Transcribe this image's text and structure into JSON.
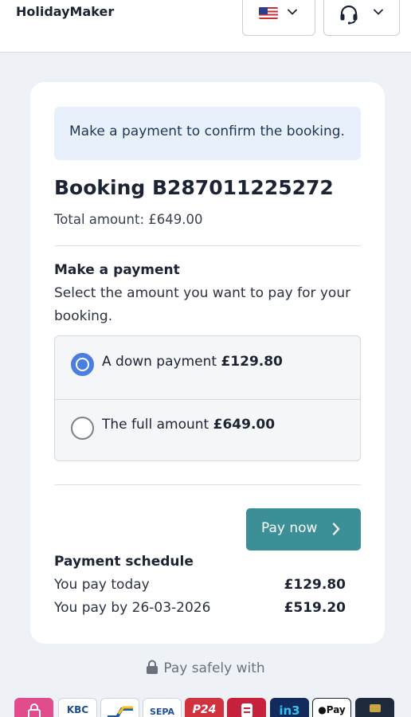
{
  "header": {
    "brand": "HolidayMaker",
    "language_icon": "us-flag-icon",
    "support_icon": "headset-icon"
  },
  "notice": "Make a payment to confirm the booking.",
  "booking": {
    "title": "Booking B287011225272",
    "total": "Total amount: £649.00"
  },
  "payment": {
    "heading": "Make a payment",
    "description": "Select the amount you want to pay for your booking.",
    "options": [
      {
        "label": "A down payment ",
        "amount": "£129.80",
        "selected": true
      },
      {
        "label": "The full amount ",
        "amount": "£649.00",
        "selected": false
      }
    ],
    "pay_button": "Pay now"
  },
  "schedule": {
    "heading": "Payment schedule",
    "rows": [
      {
        "label": "You pay today",
        "value": "£129.80"
      },
      {
        "label": "You pay by 26-03-2026",
        "value": "£519.20"
      }
    ]
  },
  "footer": {
    "safe_text": "Pay safely with",
    "methods": [
      {
        "name": "Klarna",
        "icon": "lock-bag-icon",
        "bg": "#e04c8c"
      },
      {
        "name": "KBC",
        "label": "KBC",
        "bg": "#ffffff"
      },
      {
        "name": "Bancontact",
        "icon": "bancontact-icon",
        "bg": "#ffffff"
      },
      {
        "name": "SEPA",
        "label": "SEPA",
        "bg": "#ffffff"
      },
      {
        "name": "P24",
        "label": "P24",
        "bg": "#d13240"
      },
      {
        "name": "Belfius",
        "icon": "belfius-icon",
        "bg": "#c8213d"
      },
      {
        "name": "in3",
        "label": "in3",
        "bg": "#122b5c"
      },
      {
        "name": "Apple Pay",
        "label": "Pay",
        "bg": "#ffffff"
      },
      {
        "name": "Card",
        "icon": "card-icon",
        "bg": "#1f2b3c"
      }
    ]
  },
  "colors": {
    "accent": "#3d8f97",
    "radio": "#4a7fe0",
    "notice_bg": "#e8f1fb",
    "page_bg": "#eef1f5"
  }
}
